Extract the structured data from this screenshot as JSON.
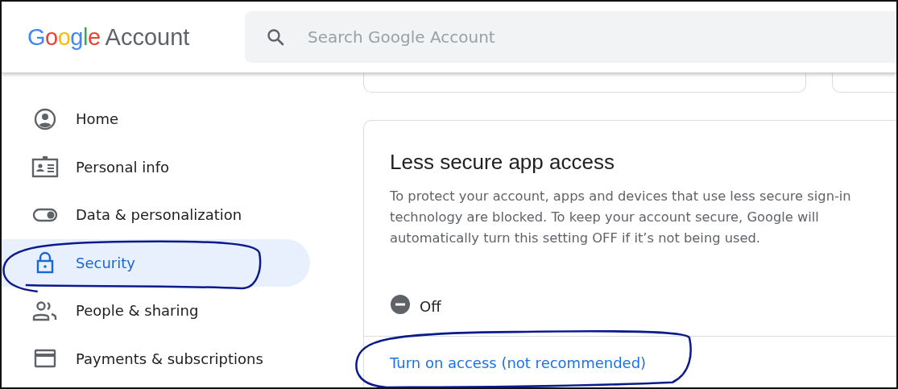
{
  "header": {
    "logo": {
      "brand": "Google",
      "product": "Account"
    },
    "search": {
      "placeholder": "Search Google Account"
    }
  },
  "sidebar": {
    "items": [
      {
        "label": "Home",
        "selected": false
      },
      {
        "label": "Personal info",
        "selected": false
      },
      {
        "label": "Data & personalization",
        "selected": false
      },
      {
        "label": "Security",
        "selected": true
      },
      {
        "label": "People & sharing",
        "selected": false
      },
      {
        "label": "Payments & subscriptions",
        "selected": false
      }
    ]
  },
  "card": {
    "title": "Less secure app access",
    "description": "To protect your account, apps and devices that use less secure sign-in technology are blocked. To keep your account secure, Google will automatically turn this setting OFF if it’s not being used.",
    "status": {
      "label": "Off",
      "on": false
    },
    "action": "Turn on access (not recommended)"
  }
}
